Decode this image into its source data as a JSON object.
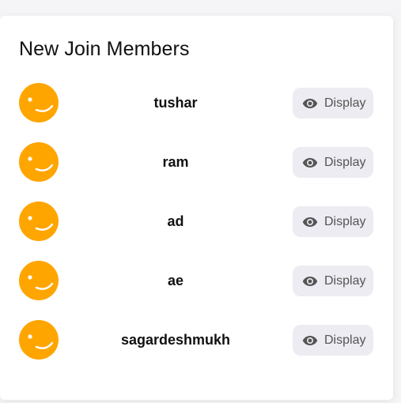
{
  "card": {
    "title": "New Join Members"
  },
  "members": [
    {
      "name": "tushar",
      "action_label": "Display",
      "avatar_icon": "smiley-face-icon",
      "action_icon": "eye-icon"
    },
    {
      "name": "ram",
      "action_label": "Display",
      "avatar_icon": "smiley-face-icon",
      "action_icon": "eye-icon"
    },
    {
      "name": "ad",
      "action_label": "Display",
      "avatar_icon": "smiley-face-icon",
      "action_icon": "eye-icon"
    },
    {
      "name": "ae",
      "action_label": "Display",
      "avatar_icon": "smiley-face-icon",
      "action_icon": "eye-icon"
    },
    {
      "name": "sagardeshmukh",
      "action_label": "Display",
      "avatar_icon": "smiley-face-icon",
      "action_icon": "eye-icon"
    }
  ],
  "colors": {
    "avatar": "#ffa500",
    "button_bg": "#ececf2",
    "button_text": "#555555",
    "title_text": "#111111"
  }
}
